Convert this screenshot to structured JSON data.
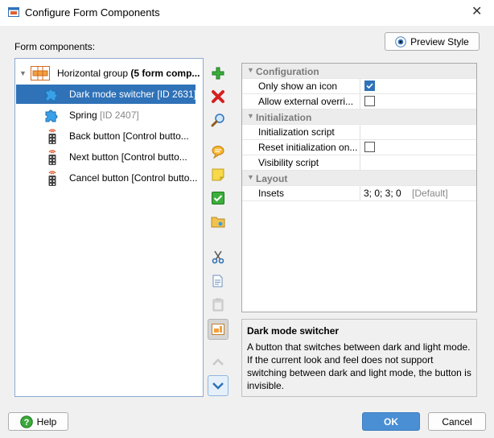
{
  "window": {
    "title": "Configure Form Components",
    "close_glyph": "✕"
  },
  "header": {
    "components_label": "Form components:",
    "preview_button": "Preview Style"
  },
  "tree": {
    "group": {
      "name": "Horizontal group ",
      "detail": "(5 form comp..."
    },
    "items": [
      {
        "name": "Dark mode switcher [ID 2631]",
        "detail": "",
        "icon": "puzzle-icon",
        "selected": true
      },
      {
        "name": "Spring ",
        "detail": "[ID 2407]",
        "icon": "puzzle-icon",
        "selected": false
      },
      {
        "name": "Back button [Control butto...",
        "detail": "",
        "icon": "remote-control-icon",
        "selected": false
      },
      {
        "name": "Next button [Control butto...",
        "detail": "",
        "icon": "remote-control-icon",
        "selected": false
      },
      {
        "name": "Cancel button [Control butto...",
        "detail": "",
        "icon": "remote-control-icon",
        "selected": false
      }
    ]
  },
  "toolbar": {
    "buttons": [
      {
        "name": "add",
        "icon": "plus-icon",
        "enabled": true
      },
      {
        "name": "delete",
        "icon": "delete-x-icon",
        "enabled": true
      },
      {
        "name": "search",
        "icon": "magnifier-icon",
        "enabled": true
      },
      {
        "name": "comment",
        "icon": "speech-bubble-icon",
        "enabled": true
      },
      {
        "name": "note",
        "icon": "sticky-note-icon",
        "enabled": true
      },
      {
        "name": "check",
        "icon": "checkmark-icon",
        "enabled": true
      },
      {
        "name": "folder",
        "icon": "folder-icon",
        "enabled": true
      },
      {
        "name": "cut",
        "icon": "scissors-icon",
        "enabled": true
      },
      {
        "name": "copy",
        "icon": "copy-icon",
        "enabled": true
      },
      {
        "name": "paste",
        "icon": "clipboard-icon",
        "enabled": false
      },
      {
        "name": "preview-layout",
        "icon": "layout-icon",
        "enabled": false
      },
      {
        "name": "move-up",
        "icon": "chevron-up-icon",
        "enabled": false
      },
      {
        "name": "move-down",
        "icon": "chevron-down-icon",
        "enabled": true
      }
    ]
  },
  "properties": {
    "categories": [
      {
        "title": "Configuration",
        "rows": [
          {
            "name": "Only show an icon",
            "type": "checkbox",
            "checked": true
          },
          {
            "name": "Allow external overri...",
            "type": "checkbox",
            "checked": false
          }
        ]
      },
      {
        "title": "Initialization",
        "rows": [
          {
            "name": "Initialization script",
            "type": "text",
            "value": ""
          },
          {
            "name": "Reset initialization on...",
            "type": "checkbox",
            "checked": false
          },
          {
            "name": "Visibility script",
            "type": "text",
            "value": ""
          }
        ]
      },
      {
        "title": "Layout",
        "rows": [
          {
            "name": "Insets",
            "type": "text",
            "value": "3; 0; 3; 0",
            "hint": "[Default]"
          }
        ]
      }
    ]
  },
  "description": {
    "title": "Dark mode switcher",
    "text": "A button that switches between dark and light mode. If the current look and feel does not support switching between dark and light mode, the button is invisible."
  },
  "footer": {
    "help": "Help",
    "ok": "OK",
    "cancel": "Cancel"
  },
  "colors": {
    "selection": "#2f72b8",
    "ok_button": "#4a8fd4",
    "border_blue": "#8ea9cf"
  }
}
